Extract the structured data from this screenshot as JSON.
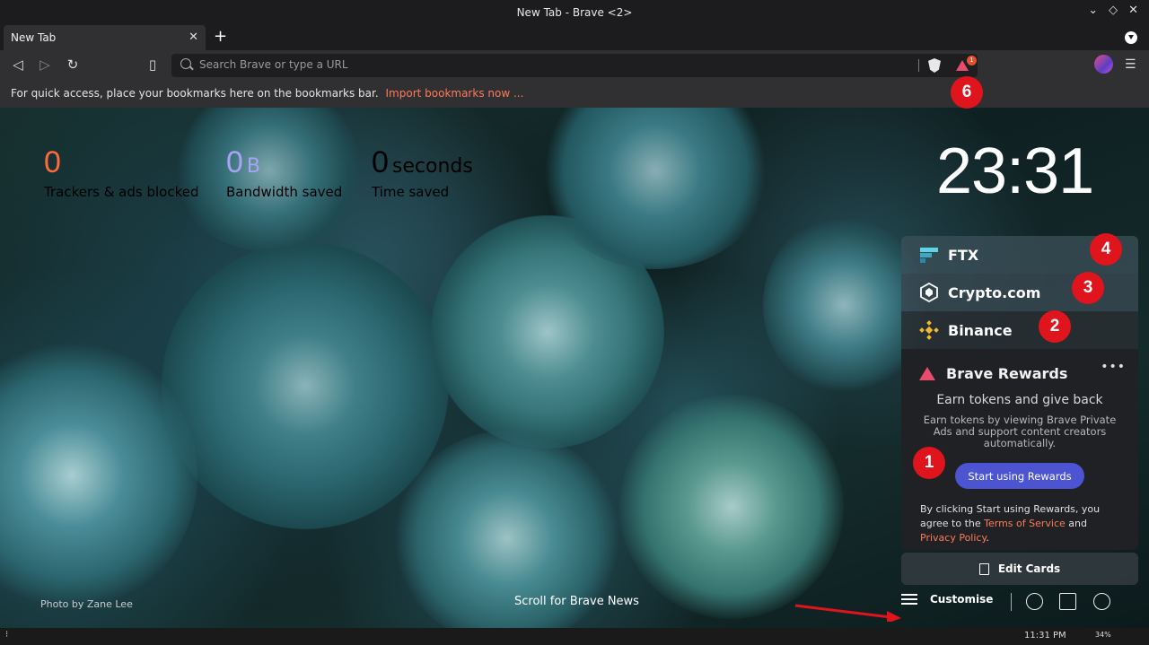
{
  "window": {
    "title": "New Tab - Brave <2>"
  },
  "tabs": [
    {
      "label": "New Tab"
    }
  ],
  "toolbar": {
    "url_placeholder": "Search Brave or type a URL",
    "rewards_badge": "1"
  },
  "bookmarks_bar": {
    "message": "For quick access, place your bookmarks here on the bookmarks bar.",
    "import_link": "Import bookmarks now ..."
  },
  "stats": {
    "trackers": {
      "value": "0",
      "label": "Trackers & ads blocked",
      "color": "#ff6a3d"
    },
    "bandwidth": {
      "value": "0",
      "unit": "B",
      "label": "Bandwidth saved",
      "color": "#a9a3f5"
    },
    "time": {
      "value": "0",
      "unit": "seconds",
      "label": "Time saved",
      "color": "#ffffff"
    }
  },
  "clock": "23:31",
  "cards": {
    "ftx": "FTX",
    "crypto": "Crypto.com",
    "binance": "Binance",
    "rewards": {
      "title": "Brave Rewards",
      "more": "•••",
      "earn_title": "Earn tokens and give back",
      "earn_desc": "Earn tokens by viewing Brave Private Ads and support content creators automatically.",
      "start_button": "Start using Rewards",
      "terms_prefix": "By clicking Start using Rewards, you agree to the",
      "terms_link": "Terms of Service",
      "terms_and": "and",
      "privacy_link": "Privacy Policy",
      "terms_suffix": "."
    },
    "edit": "Edit Cards"
  },
  "footer": {
    "photo_credit": "Photo by Zane Lee",
    "scroll_news": "Scroll for Brave News",
    "customise": "Customise"
  },
  "markers": {
    "m1": "1",
    "m2": "2",
    "m3": "3",
    "m4": "4",
    "m6": "6"
  },
  "taskbar": {
    "time": "11:31 PM",
    "battery": "34%"
  },
  "colors": {
    "accent_orange": "#ff7a59",
    "rewards_button": "#4c54d2",
    "marker_red": "#e0141c"
  }
}
